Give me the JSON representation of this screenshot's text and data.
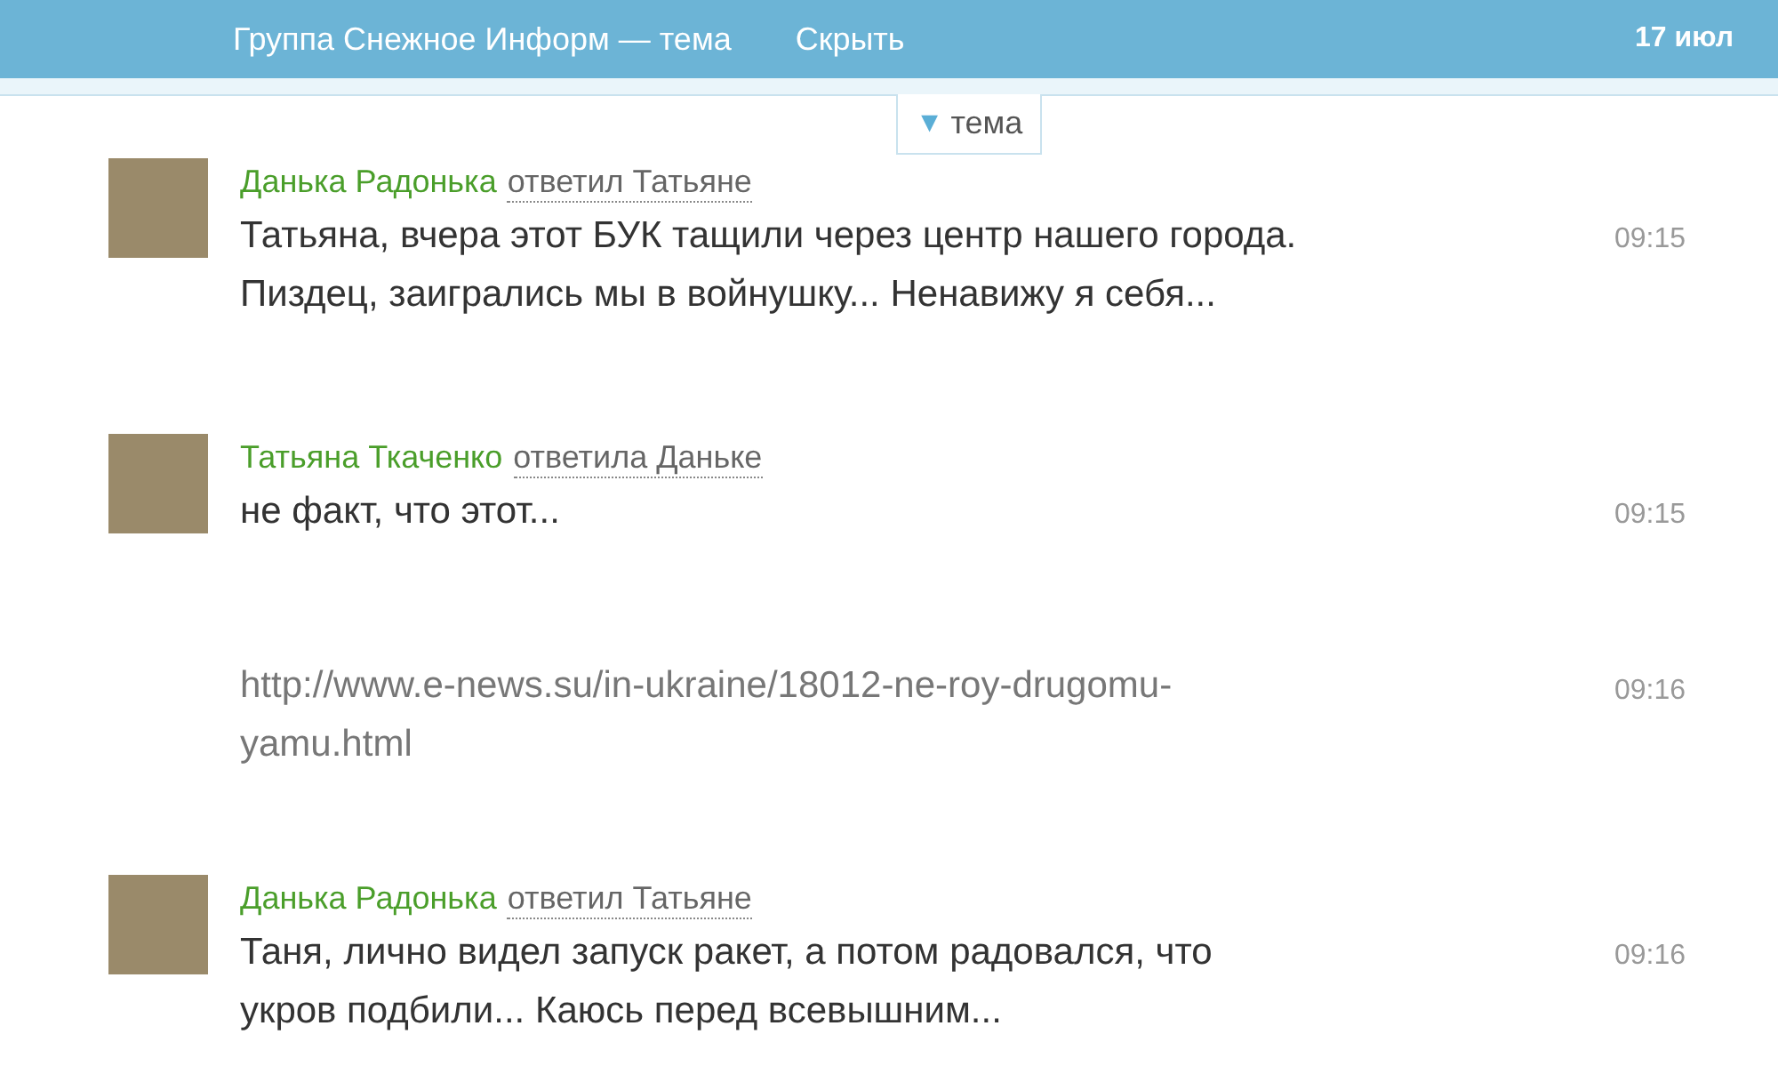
{
  "header": {
    "title": "Группа Снежное Информ — тема",
    "hide_link": "Скрыть",
    "date": "17 июл"
  },
  "topic_tab": {
    "arrow": "▼",
    "label": "тема",
    "expanded": true
  },
  "messages": [
    {
      "kind": "post",
      "author": "Данька Радонька",
      "reply_to": "ответил Татьяне",
      "lines": [
        "Татьяна, вчера этот БУК тащили через центр нашего города.",
        "Пиздец, заигрались мы в войнушку... Ненавижу я себя..."
      ],
      "time": "09:15"
    },
    {
      "kind": "post",
      "author": "Татьяна Ткаченко",
      "reply_to": "ответила Даньке",
      "lines": [
        "не факт, что этот..."
      ],
      "time": "09:15"
    },
    {
      "kind": "link",
      "lines": [
        "http://www.e-news.su/in-ukraine/18012-ne-roy-drugomu-",
        "yamu.html"
      ],
      "time": "09:16"
    },
    {
      "kind": "post",
      "author": "Данька Радонька",
      "reply_to": "ответил Татьяне",
      "lines": [
        "Таня, лично видел запуск ракет, а потом радовался, что",
        "укров подбили... Каюсь перед всевышним..."
      ],
      "time": "09:16"
    }
  ]
}
